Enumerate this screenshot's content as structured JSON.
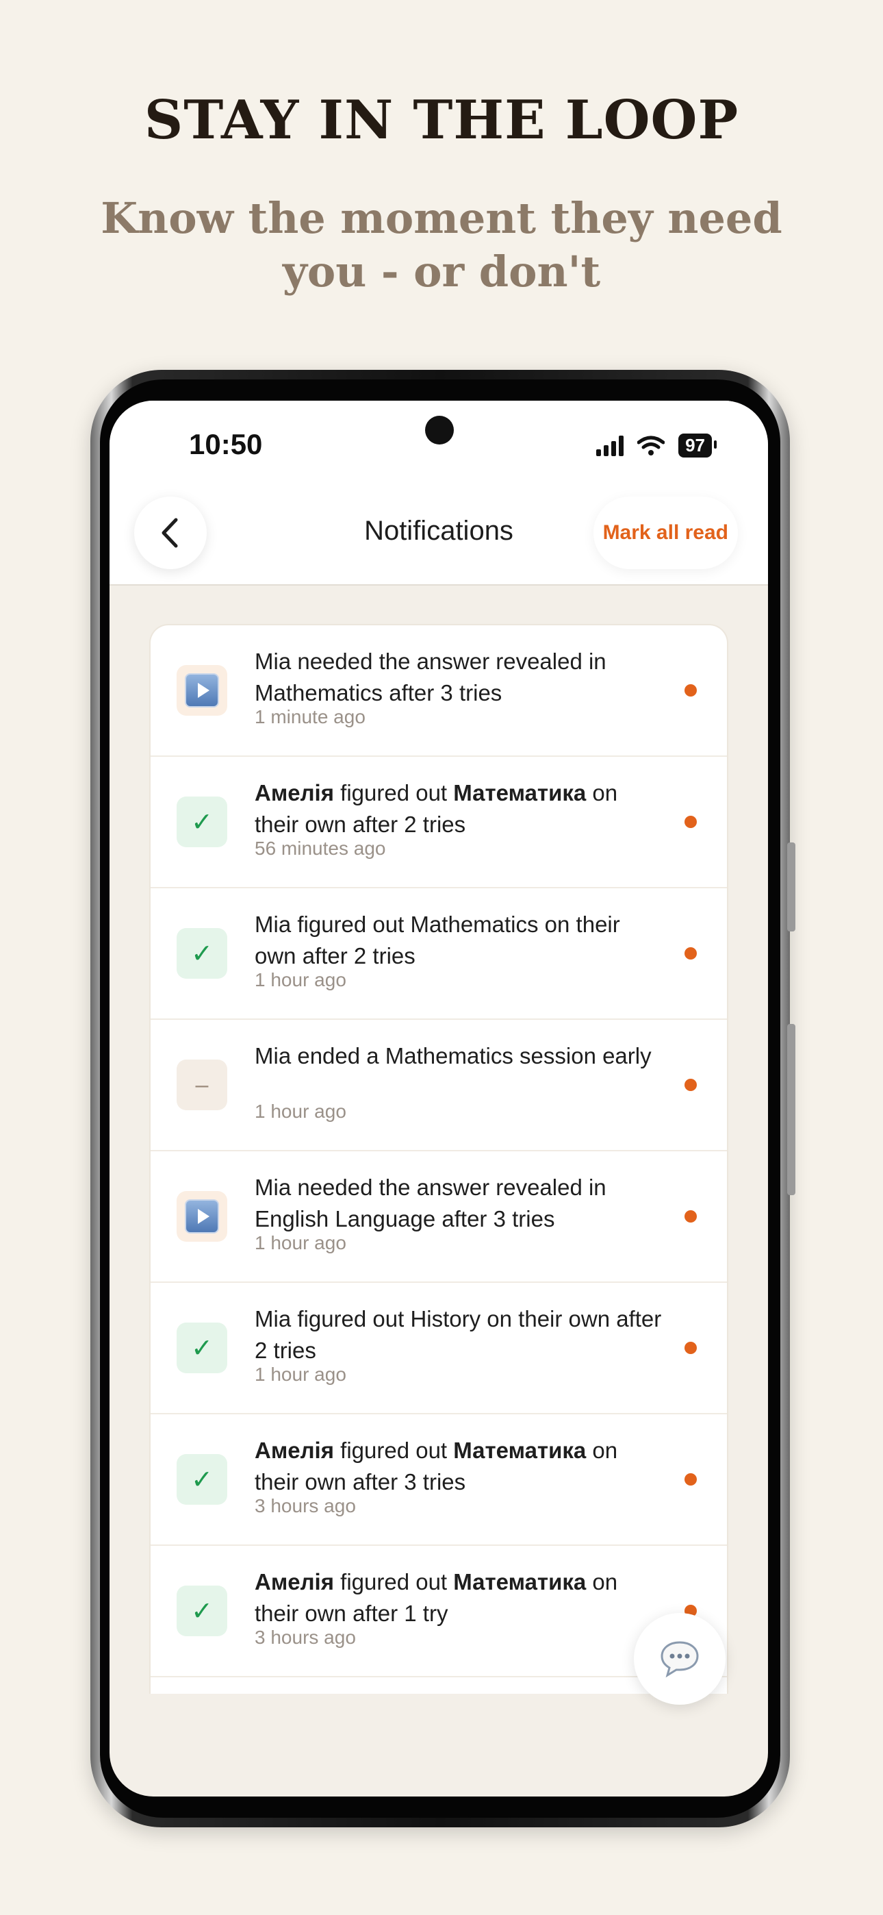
{
  "marketing": {
    "headline": "STAY IN THE LOOP",
    "subline": "Know the moment they need you - or don't"
  },
  "status_bar": {
    "time": "10:50",
    "battery": "97"
  },
  "header": {
    "title": "Notifications",
    "mark_all_read": "Mark all read"
  },
  "notifications": [
    {
      "type": "revealed",
      "parts": [
        {
          "t": "Mia needed the answer revealed in Mathematics after 3 tries",
          "b": false
        }
      ],
      "time": "1 minute ago",
      "unread": true
    },
    {
      "type": "success",
      "parts": [
        {
          "t": "Амелія",
          "b": true
        },
        {
          "t": " figured out ",
          "b": false
        },
        {
          "t": "Математика",
          "b": true
        },
        {
          "t": " on their own after 2 tries",
          "b": false
        }
      ],
      "time": "56 minutes ago",
      "unread": true
    },
    {
      "type": "success",
      "parts": [
        {
          "t": "Mia figured out Mathematics on their own after 2 tries",
          "b": false
        }
      ],
      "time": "1 hour ago",
      "unread": true
    },
    {
      "type": "ended",
      "parts": [
        {
          "t": "Mia ended a Mathematics session early",
          "b": false
        }
      ],
      "time": "1 hour ago",
      "unread": true
    },
    {
      "type": "revealed",
      "parts": [
        {
          "t": "Mia needed the answer revealed in English Language after 3 tries",
          "b": false
        }
      ],
      "time": "1 hour ago",
      "unread": true
    },
    {
      "type": "success",
      "parts": [
        {
          "t": "Mia figured out History on their own after 2 tries",
          "b": false
        }
      ],
      "time": "1 hour ago",
      "unread": true
    },
    {
      "type": "success",
      "parts": [
        {
          "t": "Амелія",
          "b": true
        },
        {
          "t": " figured out ",
          "b": false
        },
        {
          "t": "Математика",
          "b": true
        },
        {
          "t": " on their own after 3 tries",
          "b": false
        }
      ],
      "time": "3 hours ago",
      "unread": true
    },
    {
      "type": "success",
      "parts": [
        {
          "t": "Амелія",
          "b": true
        },
        {
          "t": " figured out ",
          "b": false
        },
        {
          "t": "Математика",
          "b": true
        },
        {
          "t": " on their own after 1 try",
          "b": false
        }
      ],
      "time": "3 hours ago",
      "unread": true
    }
  ],
  "icons": {
    "revealed": "play-button-icon",
    "success": "checkmark-icon",
    "ended": "dash-icon",
    "back": "chevron-left-icon",
    "chat": "chat-bubble-icon"
  },
  "colors": {
    "accent": "#e2621b",
    "success": "#1e9a4e",
    "background": "#f6f2ea",
    "headline": "#241b13",
    "subline": "#8c7a68"
  }
}
